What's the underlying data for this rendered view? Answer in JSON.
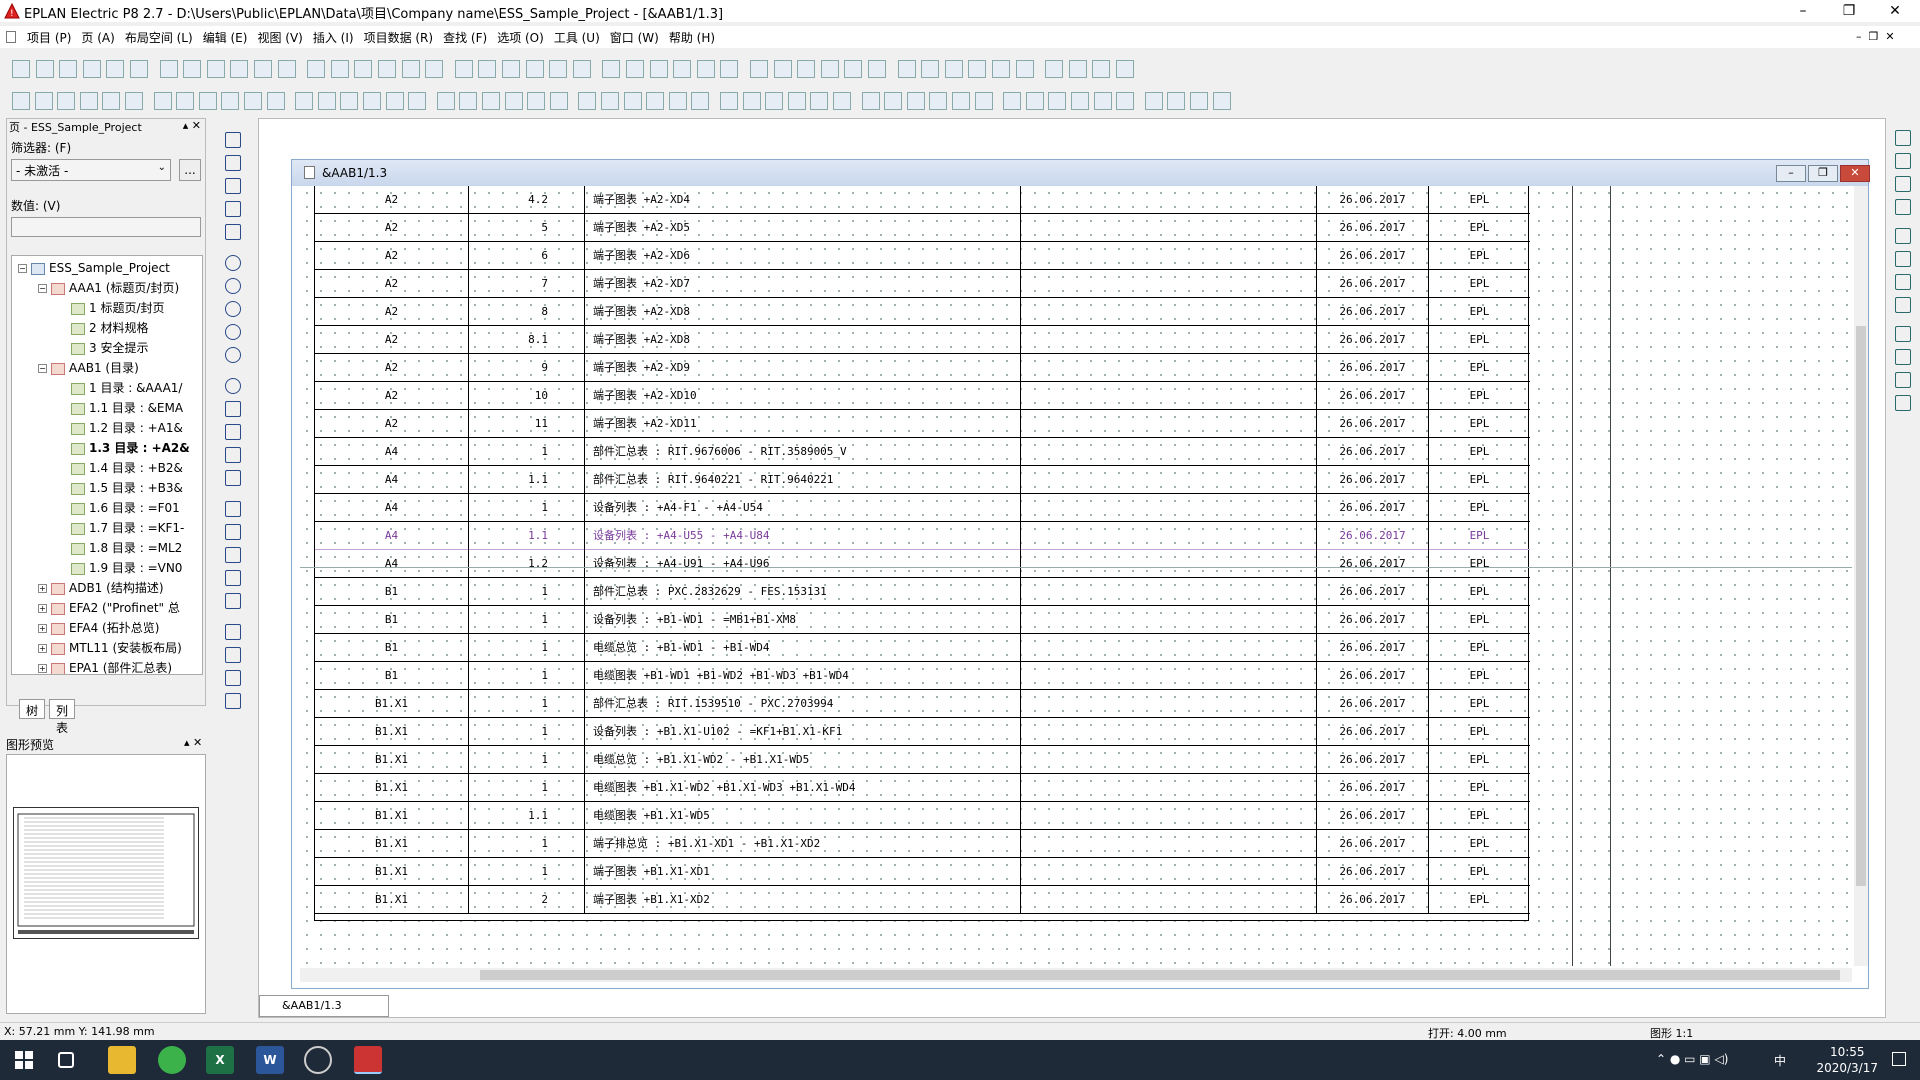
{
  "window": {
    "title": "EPLAN Electric P8 2.7 - D:\\Users\\Public\\EPLAN\\Data\\项目\\Company name\\ESS_Sample_Project - [&AAB1/1.3]",
    "minimize": "–",
    "maximize": "❐",
    "close": "✕"
  },
  "menu": {
    "items": [
      "项目 (P)",
      "页 (A)",
      "布局空间 (L)",
      "编辑 (E)",
      "视图 (V)",
      "插入 (I)",
      "项目数据 (R)",
      "查找 (F)",
      "选项 (O)",
      "工具 (U)",
      "窗口 (W)",
      "帮助 (H)"
    ]
  },
  "navigator": {
    "header": "页 - ESS_Sample_Project",
    "filter_label": "筛选器: (F)",
    "filter_value": "- 未激活 -",
    "filter_more": "...",
    "value_label": "数值: (V)",
    "tree": [
      {
        "label": "ESS_Sample_Project",
        "level": 0,
        "exp": "−",
        "icon": "proj"
      },
      {
        "label": "AAA1 (标题页/封页)",
        "level": 1,
        "exp": "−",
        "icon": "folder"
      },
      {
        "label": "1 标题页/封页",
        "level": 2,
        "icon": "page"
      },
      {
        "label": "2 材料规格",
        "level": 2,
        "icon": "page"
      },
      {
        "label": "3 安全提示",
        "level": 2,
        "icon": "page"
      },
      {
        "label": "AAB1 (目录)",
        "level": 1,
        "exp": "−",
        "icon": "folder"
      },
      {
        "label": "1 目录 : &AAA1/",
        "level": 2,
        "icon": "page"
      },
      {
        "label": "1.1 目录 : &EMA",
        "level": 2,
        "icon": "page"
      },
      {
        "label": "1.2 目录 : +A1&",
        "level": 2,
        "icon": "page"
      },
      {
        "label": "1.3 目录 : +A2&",
        "level": 2,
        "icon": "page",
        "selected": true
      },
      {
        "label": "1.4 目录 : +B2&",
        "level": 2,
        "icon": "page"
      },
      {
        "label": "1.5 目录 : +B3&",
        "level": 2,
        "icon": "page"
      },
      {
        "label": "1.6 目录 : =F01",
        "level": 2,
        "icon": "page"
      },
      {
        "label": "1.7 目录 : =KF1-",
        "level": 2,
        "icon": "page"
      },
      {
        "label": "1.8 目录 : =ML2",
        "level": 2,
        "icon": "page"
      },
      {
        "label": "1.9 目录 : =VN0",
        "level": 2,
        "icon": "page"
      },
      {
        "label": "ADB1 (结构描述)",
        "level": 1,
        "exp": "+",
        "icon": "folder"
      },
      {
        "label": "EFA2 (\"Profinet\" 总",
        "level": 1,
        "exp": "+",
        "icon": "folder"
      },
      {
        "label": "EFA4 (拓扑总览)",
        "level": 1,
        "exp": "+",
        "icon": "folder"
      },
      {
        "label": "MTL11 (安装板布局)",
        "level": 1,
        "exp": "+",
        "icon": "folder"
      },
      {
        "label": "EPA1 (部件汇总表)",
        "level": 1,
        "exp": "+",
        "icon": "folder"
      }
    ],
    "tab_tree": "树",
    "tab_list": "列表"
  },
  "preview": {
    "title": "图形预览"
  },
  "document": {
    "title": "&AAB1/1.3",
    "page_tab": "&AAB1/1.3",
    "rows": [
      {
        "loc": "A2",
        "page": "4.2",
        "desc": "端子图表 +A2-XD4",
        "date": "26.06.2017",
        "by": "EPL"
      },
      {
        "loc": "A2",
        "page": "5",
        "desc": "端子图表 +A2-XD5",
        "date": "26.06.2017",
        "by": "EPL"
      },
      {
        "loc": "A2",
        "page": "6",
        "desc": "端子图表 +A2-XD6",
        "date": "26.06.2017",
        "by": "EPL"
      },
      {
        "loc": "A2",
        "page": "7",
        "desc": "端子图表 +A2-XD7",
        "date": "26.06.2017",
        "by": "EPL"
      },
      {
        "loc": "A2",
        "page": "8",
        "desc": "端子图表 +A2-XD8",
        "date": "26.06.2017",
        "by": "EPL"
      },
      {
        "loc": "A2",
        "page": "8.1",
        "desc": "端子图表 +A2-XD8",
        "date": "26.06.2017",
        "by": "EPL"
      },
      {
        "loc": "A2",
        "page": "9",
        "desc": "端子图表 +A2-XD9",
        "date": "26.06.2017",
        "by": "EPL"
      },
      {
        "loc": "A2",
        "page": "10",
        "desc": "端子图表 +A2-XD10",
        "date": "26.06.2017",
        "by": "EPL"
      },
      {
        "loc": "A2",
        "page": "11",
        "desc": "端子图表 +A2-XD11",
        "date": "26.06.2017",
        "by": "EPL"
      },
      {
        "loc": "A4",
        "page": "1",
        "desc": "部件汇总表 : RIT.9676006 - RIT.3589005_V",
        "date": "26.06.2017",
        "by": "EPL"
      },
      {
        "loc": "A4",
        "page": "1.1",
        "desc": "部件汇总表 : RIT.9640221 - RIT.9640221",
        "date": "26.06.2017",
        "by": "EPL"
      },
      {
        "loc": "A4",
        "page": "1",
        "desc": "设备列表 : +A4-F1 - +A4-U54",
        "date": "26.06.2017",
        "by": "EPL"
      },
      {
        "loc": "A4",
        "page": "1.1",
        "desc": "设备列表 : +A4-U55 - +A4-U84",
        "date": "26.06.2017",
        "by": "EPL",
        "hl": true
      },
      {
        "loc": "A4",
        "page": "1.2",
        "desc": "设备列表 : +A4-U91 - +A4-U96",
        "date": "26.06.2017",
        "by": "EPL"
      },
      {
        "loc": "B1",
        "page": "1",
        "desc": "部件汇总表 : PXC.2832629 - FES.153131",
        "date": "26.06.2017",
        "by": "EPL"
      },
      {
        "loc": "B1",
        "page": "1",
        "desc": "设备列表 : +B1-WD1 - =MB1+B1-XM8",
        "date": "26.06.2017",
        "by": "EPL"
      },
      {
        "loc": "B1",
        "page": "1",
        "desc": "电缆总览 : +B1-WD1 - +B1-WD4",
        "date": "26.06.2017",
        "by": "EPL"
      },
      {
        "loc": "B1",
        "page": "1",
        "desc": "电缆图表 +B1-WD1 +B1-WD2 +B1-WD3 +B1-WD4",
        "date": "26.06.2017",
        "by": "EPL"
      },
      {
        "loc": "B1.X1",
        "page": "1",
        "desc": "部件汇总表 : RIT.1539510 - PXC.2703994",
        "date": "26.06.2017",
        "by": "EPL"
      },
      {
        "loc": "B1.X1",
        "page": "1",
        "desc": "设备列表 : +B1.X1-U102 - =KF1+B1.X1-KF1",
        "date": "26.06.2017",
        "by": "EPL"
      },
      {
        "loc": "B1.X1",
        "page": "1",
        "desc": "电缆总览 : +B1.X1-WD2 - +B1.X1-WD5",
        "date": "26.06.2017",
        "by": "EPL"
      },
      {
        "loc": "B1.X1",
        "page": "1",
        "desc": "电缆图表 +B1.X1-WD2 +B1.X1-WD3 +B1.X1-WD4",
        "date": "26.06.2017",
        "by": "EPL"
      },
      {
        "loc": "B1.X1",
        "page": "1.1",
        "desc": "电缆图表 +B1.X1-WD5",
        "date": "26.06.2017",
        "by": "EPL"
      },
      {
        "loc": "B1.X1",
        "page": "1",
        "desc": "端子排总览 : +B1.X1-XD1 - +B1.X1-XD2",
        "date": "26.06.2017",
        "by": "EPL"
      },
      {
        "loc": "B1.X1",
        "page": "1",
        "desc": "端子图表 +B1.X1-XD1",
        "date": "26.06.2017",
        "by": "EPL"
      },
      {
        "loc": "B1.X1",
        "page": "2",
        "desc": "端子图表 +B1.X1-XD2",
        "date": "26.06.2017",
        "by": "EPL"
      }
    ]
  },
  "status": {
    "coords": "X: 57.21 mm    Y: 141.98 mm",
    "snap": "打开: 4.00 mm",
    "scale": "图形 1:1"
  },
  "taskbar": {
    "time": "10:55",
    "date": "2020/3/17",
    "ime": "中"
  },
  "colors": {
    "highlight_row": "#7a3a9a",
    "doc_title_bg": "#c9d7ec",
    "taskbar_bg": "#1f2a38"
  }
}
